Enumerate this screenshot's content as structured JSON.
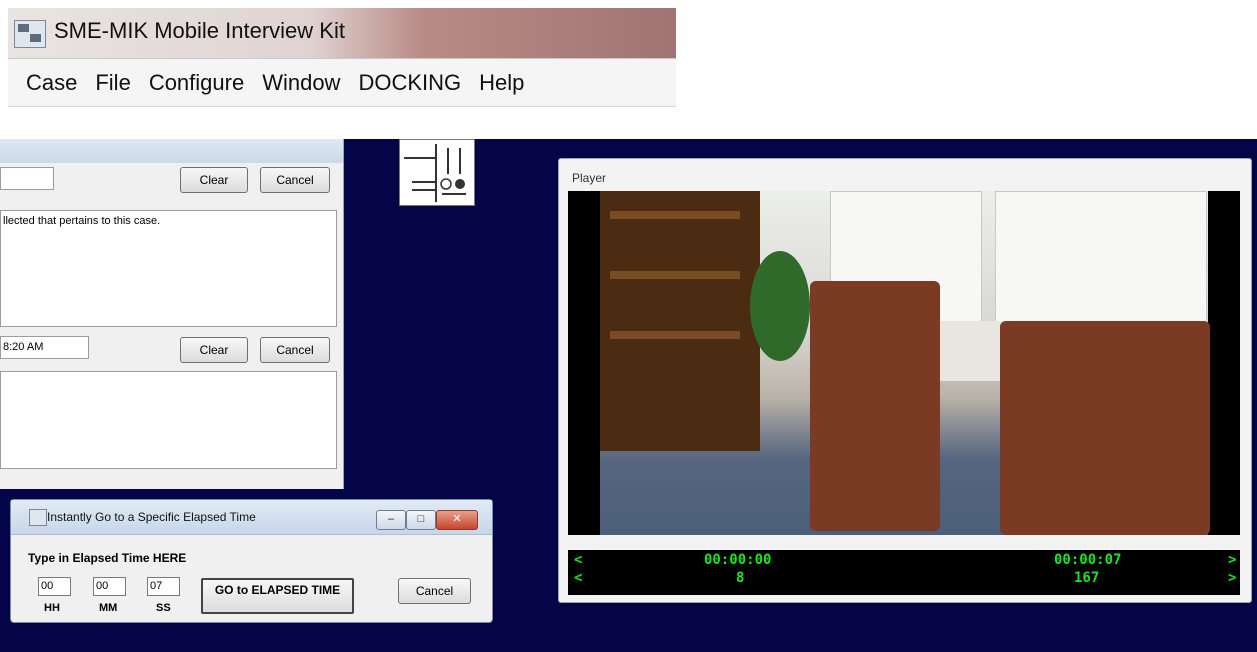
{
  "app": {
    "title": "SME-MIK Mobile Interview Kit"
  },
  "menu": [
    "Case",
    "File",
    "Configure",
    "Window",
    "DOCKING",
    "Help"
  ],
  "case_panel": {
    "row1": {
      "clear_label": "Clear",
      "cancel_label": "Cancel"
    },
    "memo1_text": "llected that pertains to this case.",
    "row2": {
      "time_value": "8:20 AM",
      "clear_label": "Clear",
      "cancel_label": "Cancel"
    }
  },
  "player": {
    "title": "Player",
    "timebar": {
      "left_arrow_top": "<",
      "left_arrow_bottom": "<",
      "right_arrow_top": ">",
      "right_arrow_bottom": ">",
      "elapsed": "00:00:00",
      "elapsed_frame": "8",
      "total": "00:00:07",
      "total_frame": "167"
    },
    "colors": {
      "timecode": "#19e61e",
      "desktop": "#030548"
    }
  },
  "dialog": {
    "title": "Instantly Go to a Specific Elapsed Time",
    "prompt": "Type in Elapsed Time HERE",
    "hh_value": "00",
    "mm_value": "00",
    "ss_value": "07",
    "hh_label": "HH",
    "mm_label": "MM",
    "ss_label": "SS",
    "go_label": "GO to ELAPSED TIME",
    "cancel_label": "Cancel"
  }
}
